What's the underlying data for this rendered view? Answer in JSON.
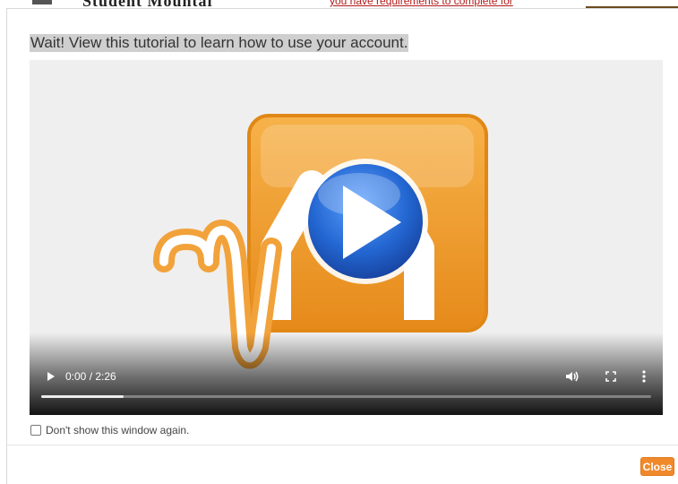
{
  "background_page": {
    "title_fragment": "Student Mountai",
    "notice_fragment": "you have requirements to complete for"
  },
  "modal": {
    "title": "Wait! View this tutorial to learn how to use your account.",
    "video": {
      "logo_icon": "orange-waveform-m-logo",
      "center_play_icon": "blue-play-button-icon",
      "current_time": "0:00",
      "duration": "2:26",
      "time_display": "0:00 / 2:26",
      "buffered_fraction": 0.135,
      "controls": [
        "play-icon",
        "volume-icon",
        "fullscreen-icon",
        "more-options-icon"
      ]
    },
    "optout_label": "Don't show this window again.",
    "optout_checked": false,
    "close_label": "Close"
  },
  "colors": {
    "accent_orange": "#f0892b",
    "logo_orange": "#f2a23a",
    "play_blue": "#2a6fd6",
    "video_bg": "#efefef"
  }
}
